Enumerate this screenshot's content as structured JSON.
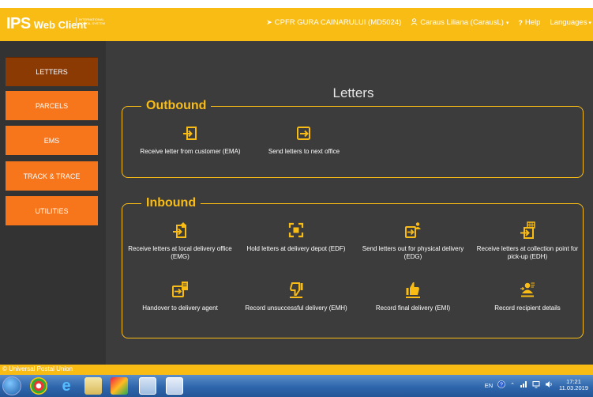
{
  "header": {
    "logo_main": "IPS",
    "logo_sub": "Web Client",
    "logo_org": "INTERNATIONAL POSTAL SYSTEM",
    "office": "CPFR GURA CAINARULUI (MD5024)",
    "user": "Caraus Liliana (CarausL)",
    "help": "Help",
    "languages": "Languages"
  },
  "sidebar": {
    "items": [
      {
        "label": "LETTERS",
        "active": true
      },
      {
        "label": "PARCELS",
        "active": false
      },
      {
        "label": "EMS",
        "active": false
      },
      {
        "label": "TRACK & TRACE",
        "active": false
      },
      {
        "label": "UTILITIES",
        "active": false
      }
    ]
  },
  "main": {
    "title": "Letters",
    "outbound": {
      "legend": "Outbound",
      "tiles": [
        {
          "label": "Receive letter from customer (EMA)",
          "icon": "receive-letter-icon"
        },
        {
          "label": "Send letters to next office",
          "icon": "send-letters-icon"
        }
      ]
    },
    "inbound": {
      "legend": "Inbound",
      "tiles": [
        {
          "label": "Receive letters at local delivery office (EMG)",
          "icon": "receive-local-icon"
        },
        {
          "label": "Hold letters at delivery depot (EDF)",
          "icon": "hold-letters-icon"
        },
        {
          "label": "Send letters out for physical delivery (EDG)",
          "icon": "send-out-delivery-icon"
        },
        {
          "label": "Receive letters at collection point for pick-up (EDH)",
          "icon": "collection-point-icon"
        },
        {
          "label": "Handover to delivery agent",
          "icon": "handover-agent-icon"
        },
        {
          "label": "Record unsuccessful delivery (EMH)",
          "icon": "thumbs-down-icon"
        },
        {
          "label": "Record final delivery (EMI)",
          "icon": "thumbs-up-icon"
        },
        {
          "label": "Record recipient details",
          "icon": "recipient-details-icon"
        }
      ]
    }
  },
  "footer": {
    "copyright": "© Universal Postal Union"
  },
  "taskbar": {
    "lang": "EN",
    "time": "17:21",
    "date": "11.03.2019"
  },
  "colors": {
    "accent": "#f9bc15",
    "nav": "#f7751b",
    "nav_active": "#8c3a04",
    "background": "#3c3c3c",
    "sidebar": "#333333"
  }
}
